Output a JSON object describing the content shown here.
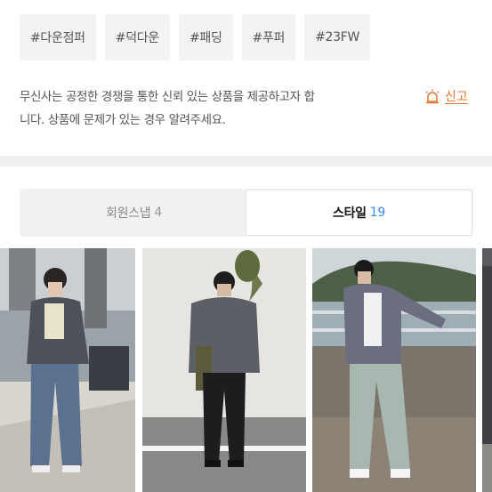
{
  "tags": [
    "#다운점퍼",
    "#덕다운",
    "#패딩",
    "#푸퍼",
    "#23FW"
  ],
  "notice": {
    "line1": "무신사는 공정한 경쟁을 통한 신뢰 있는 상품을 제공하고자 합",
    "line2": "니다. 상품에 문제가 있는 경우 알려주세요."
  },
  "report": {
    "label": "신고",
    "icon": "siren-icon",
    "color": "#e8732f"
  },
  "tabs": [
    {
      "label": "회원스냅",
      "count": "4",
      "active": false
    },
    {
      "label": "스타일",
      "count": "19",
      "active": true
    }
  ],
  "accent_color": "#2f8cf0",
  "photos": [
    {
      "alt_icon": "style-photo-1"
    },
    {
      "alt_icon": "style-photo-2"
    },
    {
      "alt_icon": "style-photo-3"
    },
    {
      "alt_icon": "style-photo-4"
    }
  ]
}
